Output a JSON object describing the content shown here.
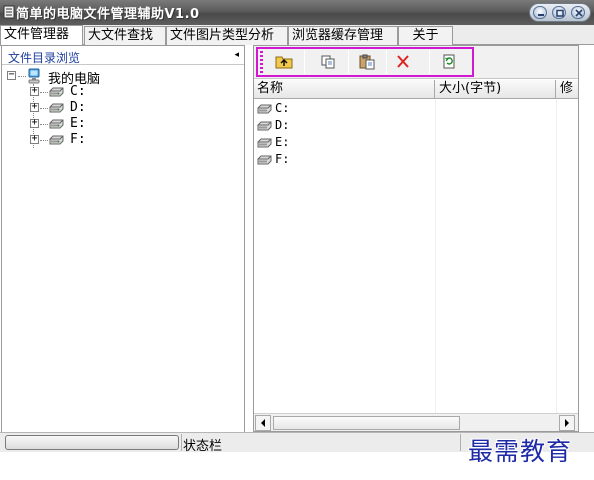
{
  "window": {
    "title": "简单的电脑文件管理辅助V1.0",
    "controls": {
      "minimize_icon": "minimize-icon",
      "maximize_icon": "maximize-icon",
      "close_icon": "close-icon"
    }
  },
  "tabs": [
    {
      "label": "文件管理器",
      "active": true
    },
    {
      "label": "大文件查找",
      "active": false
    },
    {
      "label": "文件图片类型分析",
      "active": false
    },
    {
      "label": "浏览器缓存管理",
      "active": false
    },
    {
      "label": "关于",
      "active": false
    }
  ],
  "tree": {
    "header": "文件目录浏览",
    "pin_glyph": "◂",
    "root": {
      "label": "我的电脑",
      "expander": "−",
      "icon": "computer-icon"
    },
    "drives": [
      {
        "label": "C:",
        "expander": "+",
        "icon": "drive-icon"
      },
      {
        "label": "D:",
        "expander": "+",
        "icon": "drive-icon"
      },
      {
        "label": "E:",
        "expander": "+",
        "icon": "drive-icon"
      },
      {
        "label": "F:",
        "expander": "+",
        "icon": "drive-icon"
      }
    ]
  },
  "toolbar": {
    "buttons": [
      {
        "name": "up-folder-button",
        "icon": "folder-up-icon"
      },
      {
        "name": "copy-button",
        "icon": "copy-icon"
      },
      {
        "name": "paste-button",
        "icon": "paste-icon"
      },
      {
        "name": "delete-button",
        "icon": "delete-icon"
      },
      {
        "name": "refresh-button",
        "icon": "refresh-icon"
      }
    ],
    "highlight_color": "#d117d1"
  },
  "list": {
    "columns": [
      "名称",
      "大小(字节)",
      "修"
    ],
    "items": [
      {
        "name": "C:",
        "icon": "drive-icon"
      },
      {
        "name": "D:",
        "icon": "drive-icon"
      },
      {
        "name": "E:",
        "icon": "drive-icon"
      },
      {
        "name": "F:",
        "icon": "drive-icon"
      }
    ],
    "scroll": {
      "left_arrow": "◂",
      "right_arrow": "▸"
    }
  },
  "statusbar": {
    "label": "状态栏",
    "progress": 0
  },
  "watermark": "最需教育"
}
